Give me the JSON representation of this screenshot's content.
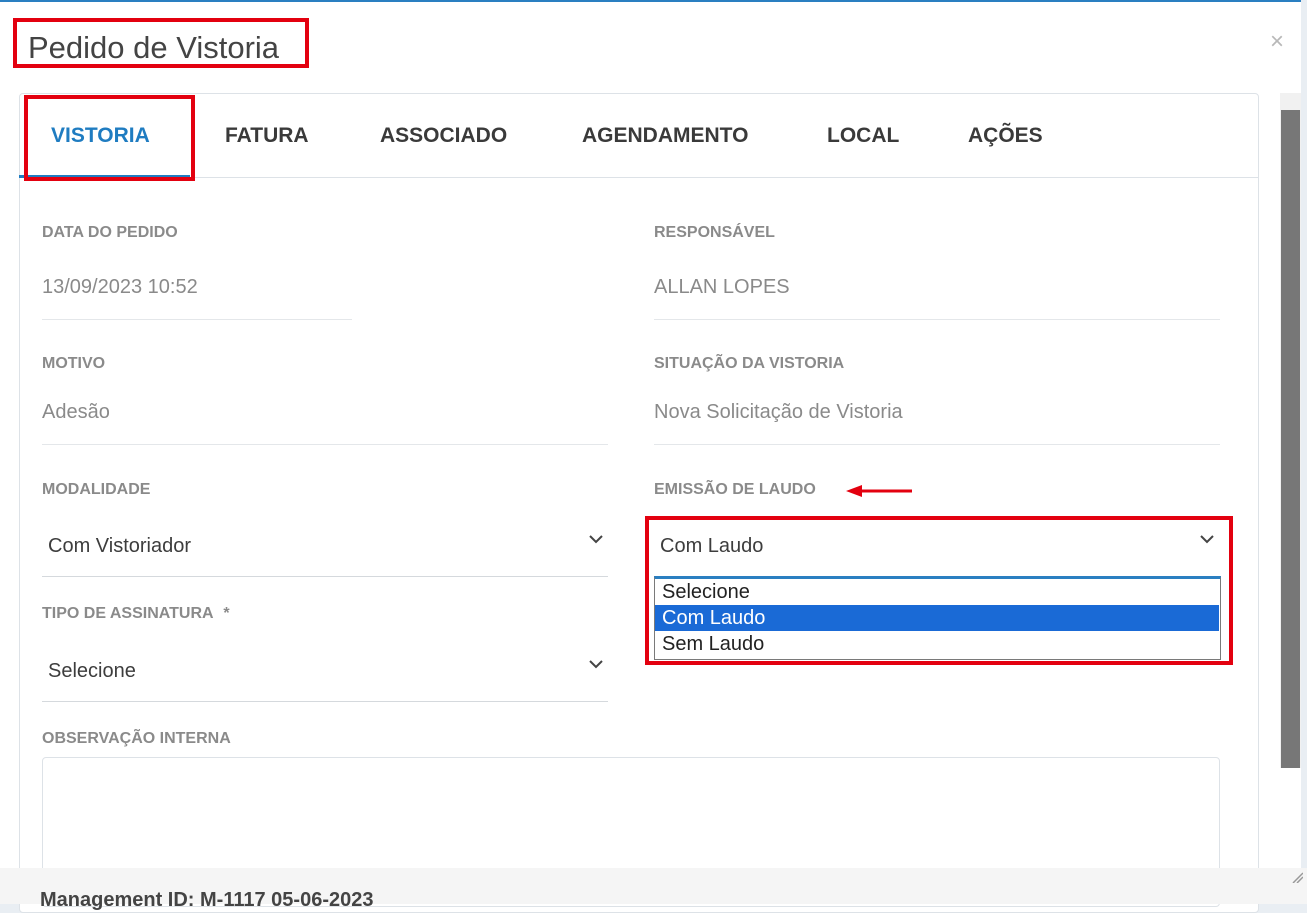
{
  "modal": {
    "title": "Pedido de Vistoria",
    "close": "×"
  },
  "tabs": [
    {
      "label": "VISTORIA",
      "active": true
    },
    {
      "label": "FATURA"
    },
    {
      "label": "ASSOCIADO"
    },
    {
      "label": "AGENDAMENTO"
    },
    {
      "label": "LOCAL"
    },
    {
      "label": "AÇÕES"
    }
  ],
  "fields": {
    "data_pedido": {
      "label": "DATA DO PEDIDO",
      "value": "13/09/2023 10:52"
    },
    "responsavel": {
      "label": "RESPONSÁVEL",
      "value": "ALLAN LOPES"
    },
    "motivo": {
      "label": "MOTIVO",
      "value": "Adesão"
    },
    "situacao": {
      "label": "SITUAÇÃO DA VISTORIA",
      "value": "Nova Solicitação de Vistoria"
    },
    "modalidade": {
      "label": "MODALIDADE",
      "value": "Com Vistoriador"
    },
    "emissao_laudo": {
      "label": "EMISSÃO DE LAUDO",
      "value": "Com Laudo",
      "options": [
        "Selecione",
        "Com Laudo",
        "Sem Laudo"
      ],
      "selected_index": 1
    },
    "tipo_assinatura": {
      "label": "TIPO DE ASSINATURA",
      "required_mark": "*",
      "value": "Selecione"
    },
    "observacao": {
      "label": "OBSERVAÇÃO INTERNA",
      "value": ""
    }
  },
  "background": {
    "peek_text": "Management ID: M-1117 05-06-2023"
  },
  "colors": {
    "accent": "#1f7cc1",
    "highlight": "#e3000f",
    "option_selected": "#1a6ad6"
  }
}
